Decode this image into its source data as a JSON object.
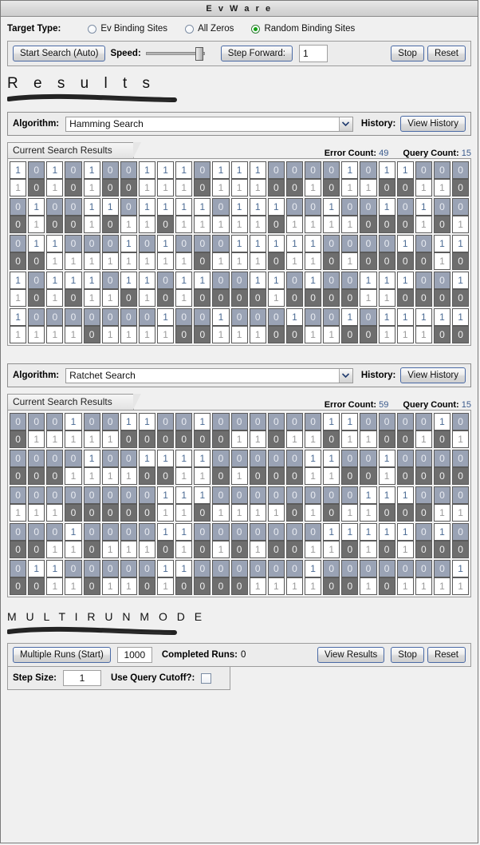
{
  "window": {
    "title": "E v   W a r e"
  },
  "target": {
    "label": "Target Type:",
    "options": [
      {
        "label": "Ev Binding Sites",
        "selected": false
      },
      {
        "label": "All Zeros",
        "selected": false
      },
      {
        "label": "Random Binding Sites",
        "selected": true
      }
    ]
  },
  "controls": {
    "start_label": "Start Search (Auto)",
    "speed_label": "Speed:",
    "speed_value": 85,
    "step_label": "Step Forward:",
    "step_value": "1",
    "stop_label": "Stop",
    "reset_label": "Reset"
  },
  "results_heading": "R e s u l t s",
  "multirun_heading": "M U L T I   R U N   M O D E",
  "labels": {
    "algorithm": "Algorithm:",
    "history": "History:",
    "view_history": "View History",
    "current_results_tab": "Current Search Results",
    "error_count": "Error Count:",
    "query_count": "Query Count:"
  },
  "sections": [
    {
      "algorithm": "Hamming Search",
      "error_count": "49",
      "query_count": "15",
      "rows": [
        {
          "target": [
            1,
            0,
            1,
            0,
            1,
            0,
            0,
            1,
            1,
            1,
            0,
            1,
            1,
            1,
            0,
            0,
            0,
            0,
            1,
            0,
            1,
            1,
            0,
            0,
            0
          ],
          "current": [
            1,
            0,
            1,
            0,
            1,
            0,
            0,
            1,
            1,
            1,
            0,
            1,
            1,
            1,
            0,
            0,
            1,
            0,
            1,
            1,
            0,
            0,
            1,
            1,
            0
          ]
        },
        {
          "target": [
            0,
            1,
            0,
            0,
            1,
            1,
            0,
            1,
            1,
            1,
            1,
            0,
            1,
            1,
            1,
            0,
            0,
            1,
            0,
            0,
            1,
            0,
            1,
            0,
            0
          ],
          "current": [
            0,
            1,
            0,
            0,
            1,
            0,
            1,
            1,
            0,
            1,
            1,
            1,
            1,
            1,
            0,
            1,
            1,
            1,
            1,
            0,
            0,
            0,
            1,
            0,
            1
          ]
        },
        {
          "target": [
            0,
            1,
            1,
            0,
            0,
            0,
            1,
            0,
            1,
            0,
            0,
            0,
            1,
            1,
            1,
            1,
            1,
            0,
            0,
            0,
            0,
            1,
            0,
            1,
            1
          ],
          "current": [
            0,
            0,
            1,
            1,
            1,
            1,
            1,
            1,
            1,
            1,
            0,
            1,
            1,
            1,
            0,
            1,
            1,
            0,
            1,
            0,
            0,
            0,
            0,
            1,
            0
          ]
        },
        {
          "target": [
            1,
            0,
            1,
            1,
            1,
            0,
            1,
            1,
            0,
            1,
            1,
            0,
            0,
            1,
            1,
            0,
            1,
            0,
            0,
            1,
            1,
            1,
            0,
            0,
            1
          ],
          "current": [
            1,
            0,
            1,
            0,
            1,
            1,
            0,
            1,
            0,
            1,
            0,
            0,
            0,
            0,
            1,
            0,
            0,
            0,
            0,
            1,
            1,
            0,
            0,
            0,
            0
          ]
        },
        {
          "target": [
            1,
            0,
            0,
            0,
            0,
            0,
            0,
            0,
            1,
            0,
            0,
            1,
            0,
            0,
            0,
            1,
            0,
            0,
            1,
            0,
            1,
            1,
            1,
            1,
            1
          ],
          "current": [
            1,
            1,
            1,
            1,
            0,
            1,
            1,
            1,
            1,
            0,
            0,
            1,
            1,
            1,
            0,
            0,
            1,
            1,
            0,
            0,
            1,
            1,
            1,
            0,
            0
          ]
        }
      ]
    },
    {
      "algorithm": "Ratchet Search",
      "error_count": "59",
      "query_count": "15",
      "rows": [
        {
          "target": [
            0,
            0,
            0,
            1,
            0,
            0,
            1,
            1,
            0,
            0,
            1,
            0,
            0,
            0,
            0,
            0,
            0,
            1,
            1,
            0,
            0,
            0,
            0,
            1,
            0
          ],
          "current": [
            0,
            1,
            1,
            1,
            1,
            1,
            0,
            0,
            0,
            0,
            0,
            0,
            1,
            1,
            0,
            1,
            1,
            0,
            1,
            1,
            0,
            0,
            1,
            0,
            1
          ]
        },
        {
          "target": [
            0,
            0,
            0,
            0,
            1,
            0,
            0,
            1,
            1,
            1,
            1,
            0,
            0,
            0,
            0,
            0,
            1,
            1,
            0,
            0,
            1,
            0,
            0,
            0,
            0
          ],
          "current": [
            0,
            0,
            0,
            1,
            1,
            1,
            1,
            0,
            0,
            1,
            1,
            0,
            1,
            0,
            0,
            0,
            1,
            1,
            0,
            0,
            1,
            0,
            0,
            0,
            0
          ]
        },
        {
          "target": [
            0,
            0,
            0,
            0,
            0,
            0,
            0,
            0,
            1,
            1,
            1,
            0,
            0,
            0,
            0,
            0,
            0,
            0,
            0,
            1,
            1,
            1,
            0,
            0,
            0
          ],
          "current": [
            1,
            1,
            1,
            0,
            0,
            0,
            0,
            0,
            1,
            1,
            0,
            1,
            1,
            1,
            1,
            0,
            1,
            0,
            1,
            1,
            0,
            0,
            0,
            1,
            1
          ]
        },
        {
          "target": [
            0,
            0,
            0,
            1,
            0,
            0,
            0,
            0,
            1,
            1,
            0,
            0,
            0,
            0,
            0,
            0,
            0,
            1,
            1,
            1,
            1,
            1,
            0,
            1,
            0
          ],
          "current": [
            0,
            0,
            1,
            1,
            0,
            1,
            1,
            1,
            0,
            1,
            0,
            1,
            0,
            1,
            0,
            0,
            1,
            1,
            0,
            1,
            0,
            1,
            0,
            0,
            0
          ]
        },
        {
          "target": [
            0,
            1,
            1,
            0,
            0,
            0,
            0,
            0,
            1,
            1,
            0,
            0,
            0,
            0,
            0,
            0,
            1,
            0,
            0,
            0,
            0,
            0,
            0,
            0,
            1
          ],
          "current": [
            0,
            0,
            1,
            1,
            0,
            1,
            1,
            0,
            1,
            0,
            0,
            0,
            0,
            1,
            1,
            1,
            1,
            0,
            0,
            1,
            0,
            1,
            1,
            1,
            1
          ]
        }
      ]
    }
  ],
  "multirun": {
    "start_label": "Multiple Runs (Start)",
    "runs_value": "1000",
    "completed_label": "Completed Runs:",
    "completed_value": "0",
    "view_results_label": "View Results",
    "stop_label": "Stop",
    "reset_label": "Reset",
    "step_size_label": "Step Size:",
    "step_size_value": "1",
    "cutoff_label": "Use Query Cutoff?:",
    "cutoff_checked": false
  }
}
